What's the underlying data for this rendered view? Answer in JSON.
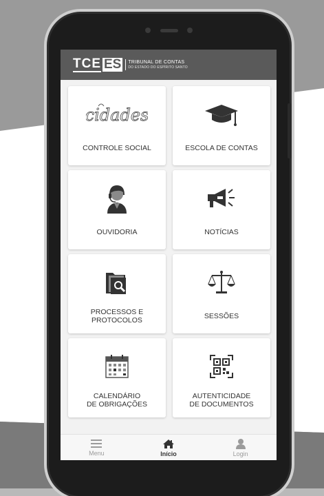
{
  "header": {
    "logo_tc": "TCE",
    "logo_es": "ES",
    "logo_line1": "TRIBUNAL DE CONTAS",
    "logo_line2": "DO ESTADO DO ESPÍRITO SANTO"
  },
  "tiles": [
    {
      "label": "CONTROLE SOCIAL",
      "icon": "cidades-logo-icon",
      "icon_text": "cidades"
    },
    {
      "label": "ESCOLA DE CONTAS",
      "icon": "graduation-cap-icon"
    },
    {
      "label": "OUVIDORIA",
      "icon": "user-headset-icon"
    },
    {
      "label": "NOTÍCIAS",
      "icon": "megaphone-icon"
    },
    {
      "label": "PROCESSOS E\nPROTOCOLOS",
      "icon": "folder-search-icon"
    },
    {
      "label": "SESSÕES",
      "icon": "scales-icon"
    },
    {
      "label": "CALENDÁRIO\nDE OBRIGAÇÕES",
      "icon": "calendar-icon"
    },
    {
      "label": "AUTENTICIDADE\nDE DOCUMENTOS",
      "icon": "qr-code-icon"
    }
  ],
  "nav": {
    "menu": "Menu",
    "home": "Início",
    "login": "Login",
    "active": "home"
  },
  "colors": {
    "header_bg": "#5a5a5a",
    "icon_dark": "#333333",
    "icon_light": "#8a8a8a"
  }
}
